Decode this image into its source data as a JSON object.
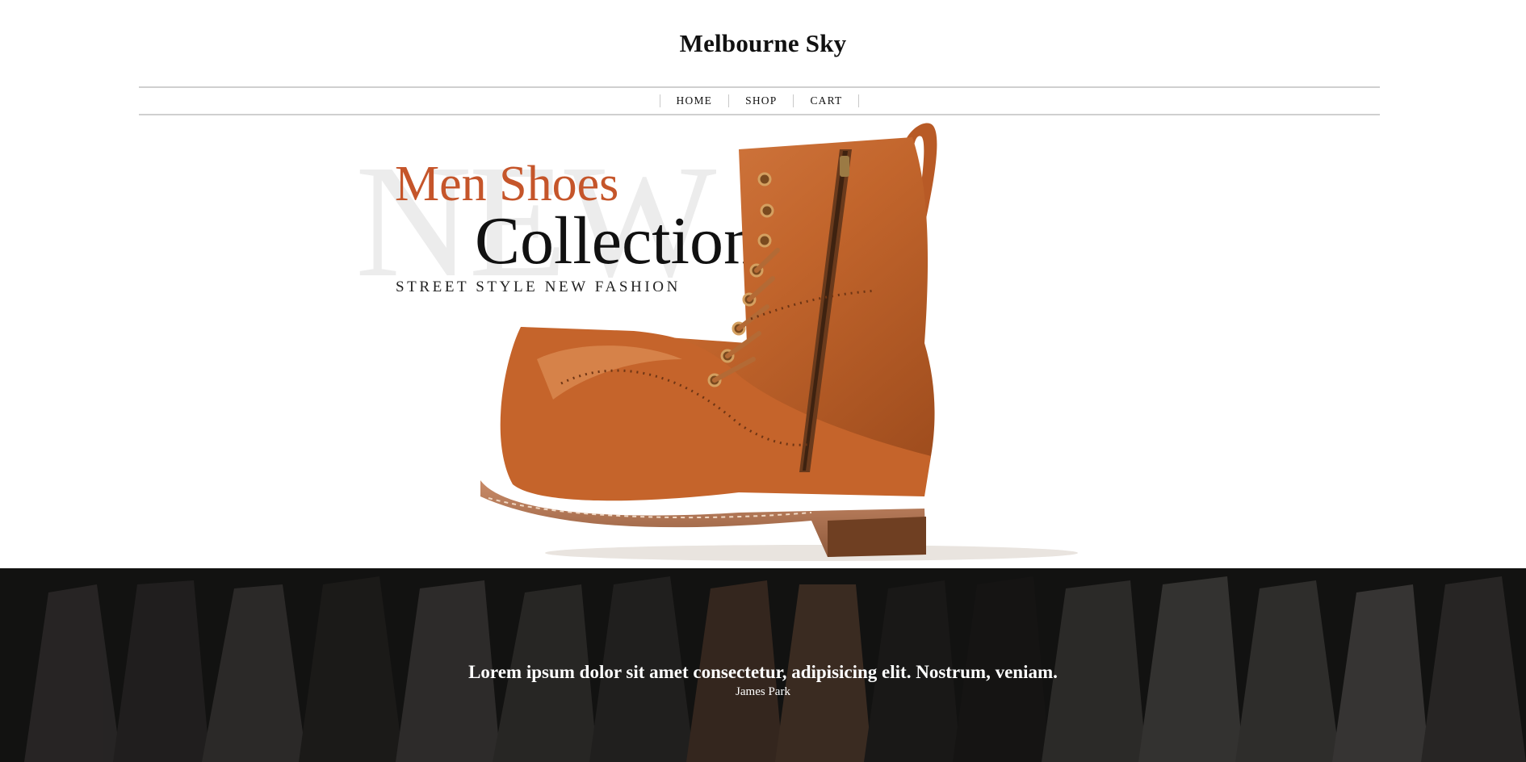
{
  "site": {
    "title": "Melbourne Sky"
  },
  "nav": {
    "items": [
      "HOME",
      "SHOP",
      "CART"
    ]
  },
  "hero": {
    "watermark": "NEW",
    "subtitle": "Men Shoes",
    "title": "Collection",
    "tagline": "STREET STYLE NEW FASHION",
    "accent_color": "#c5552a",
    "image": "brown-leather-boot"
  },
  "testimonial": {
    "quote": "Lorem ipsum dolor sit amet consectetur, adipisicing elit. Nostrum, veniam.",
    "author": "James Park",
    "background": "clothing-rack-photo"
  }
}
